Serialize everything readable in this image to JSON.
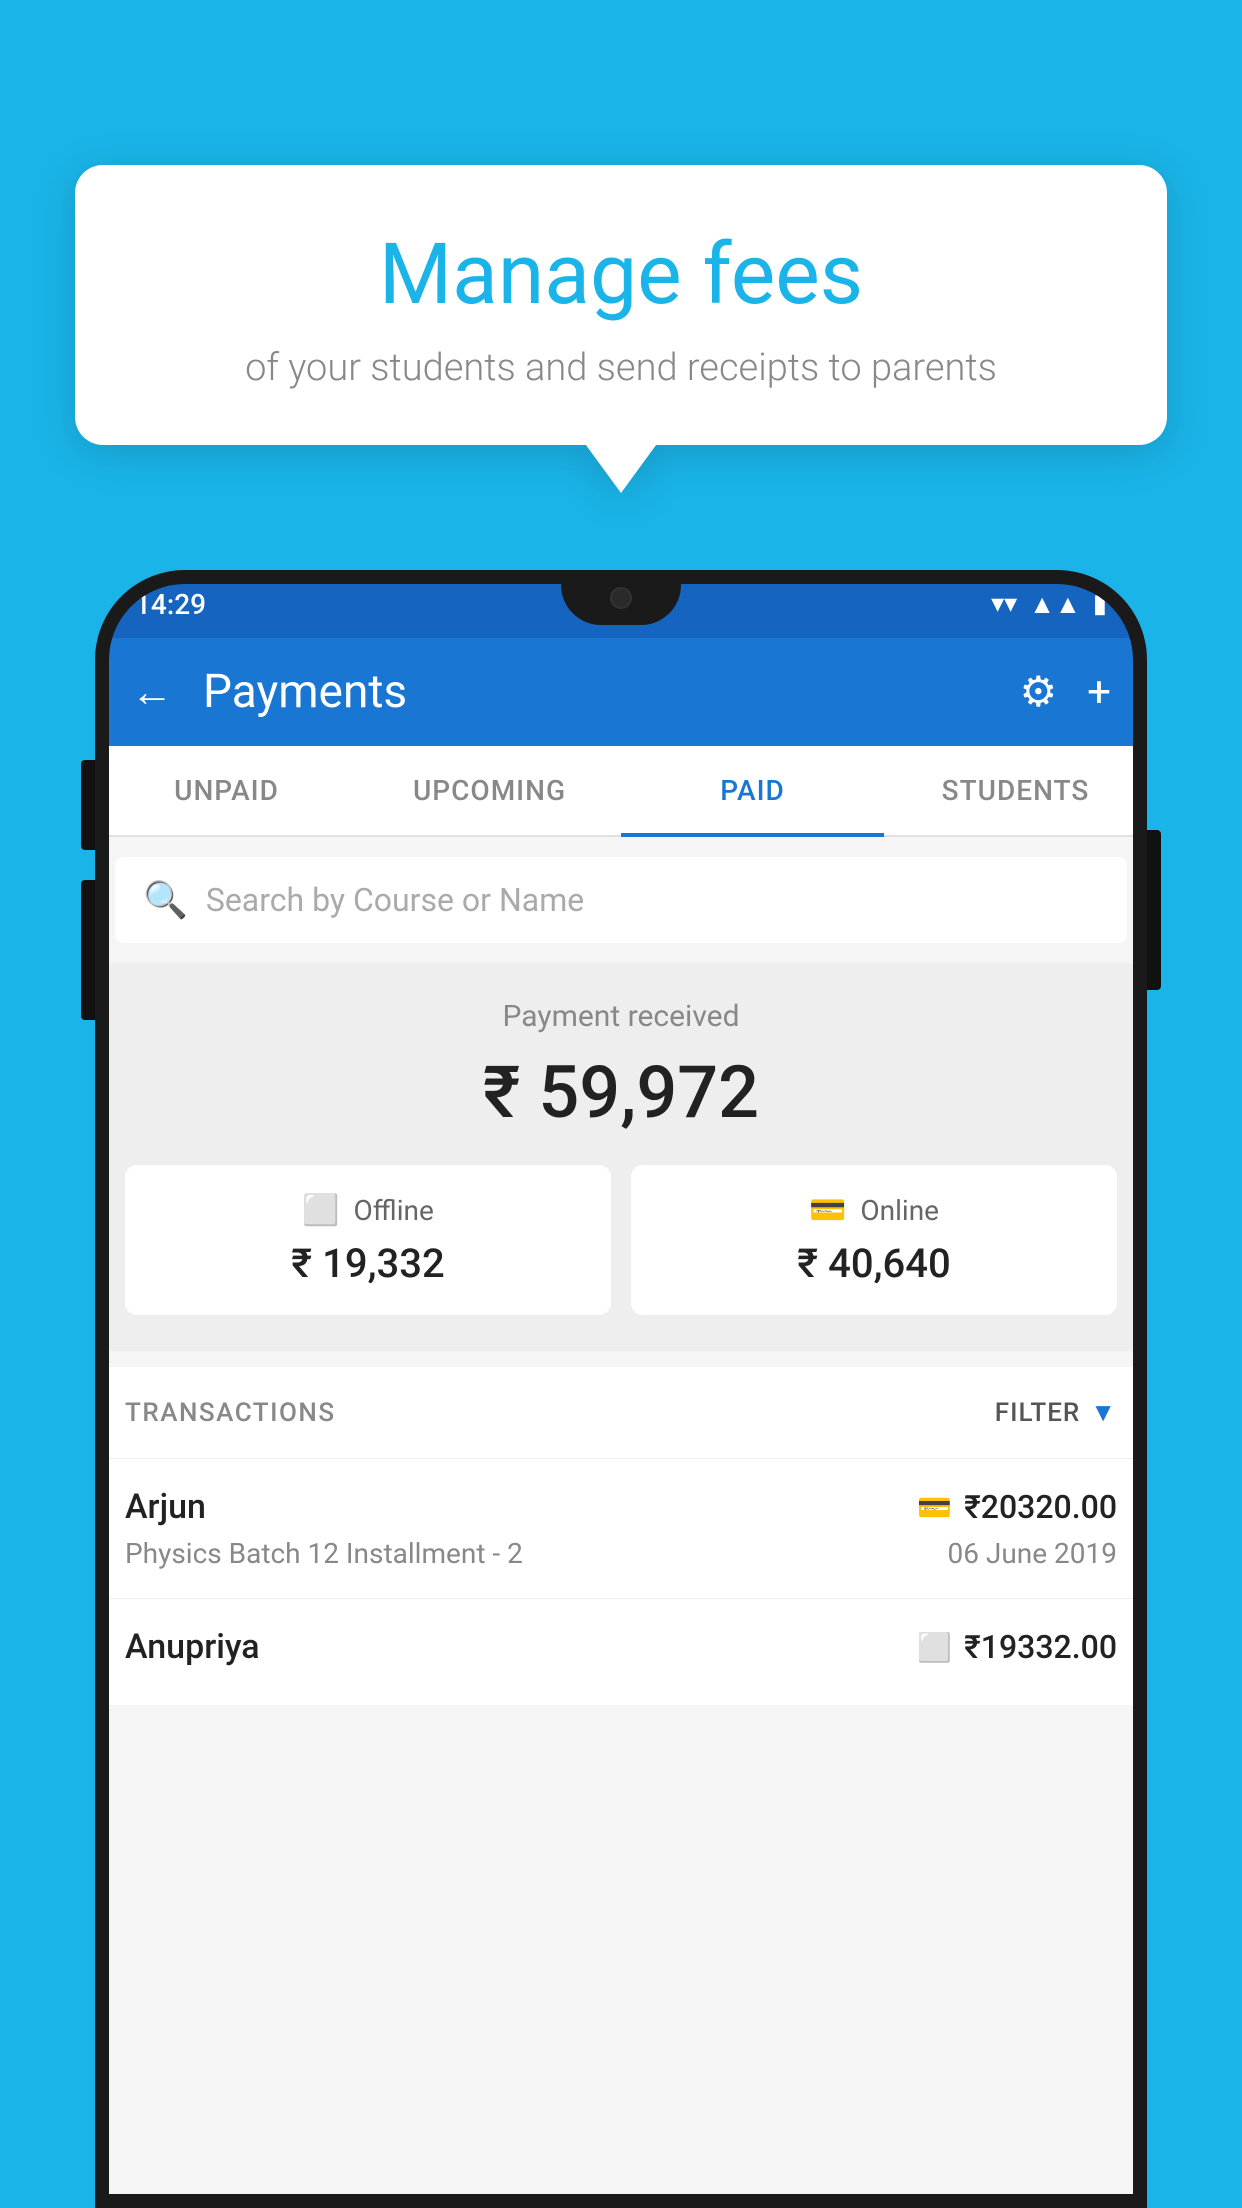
{
  "bubble": {
    "title": "Manage fees",
    "subtitle": "of your students and send receipts to parents"
  },
  "status_bar": {
    "time": "14:29"
  },
  "app_bar": {
    "title": "Payments",
    "back_label": "←",
    "gear_label": "⚙",
    "plus_label": "+"
  },
  "tabs": [
    {
      "label": "UNPAID",
      "active": false
    },
    {
      "label": "UPCOMING",
      "active": false
    },
    {
      "label": "PAID",
      "active": true
    },
    {
      "label": "STUDENTS",
      "active": false
    }
  ],
  "search": {
    "placeholder": "Search by Course or Name"
  },
  "payment_section": {
    "label": "Payment received",
    "total": "₹ 59,972",
    "offline_label": "Offline",
    "offline_amount": "₹ 19,332",
    "online_label": "Online",
    "online_amount": "₹ 40,640"
  },
  "transactions_header": {
    "label": "TRANSACTIONS",
    "filter_label": "FILTER"
  },
  "transactions": [
    {
      "name": "Arjun",
      "amount": "₹20320.00",
      "course": "Physics Batch 12 Installment - 2",
      "date": "06 June 2019",
      "payment_type": "card"
    },
    {
      "name": "Anupriya",
      "amount": "₹19332.00",
      "course": "",
      "date": "",
      "payment_type": "offline"
    }
  ],
  "colors": {
    "primary": "#1976d2",
    "accent": "#1ab4e8",
    "bg": "#f5f5f5"
  }
}
